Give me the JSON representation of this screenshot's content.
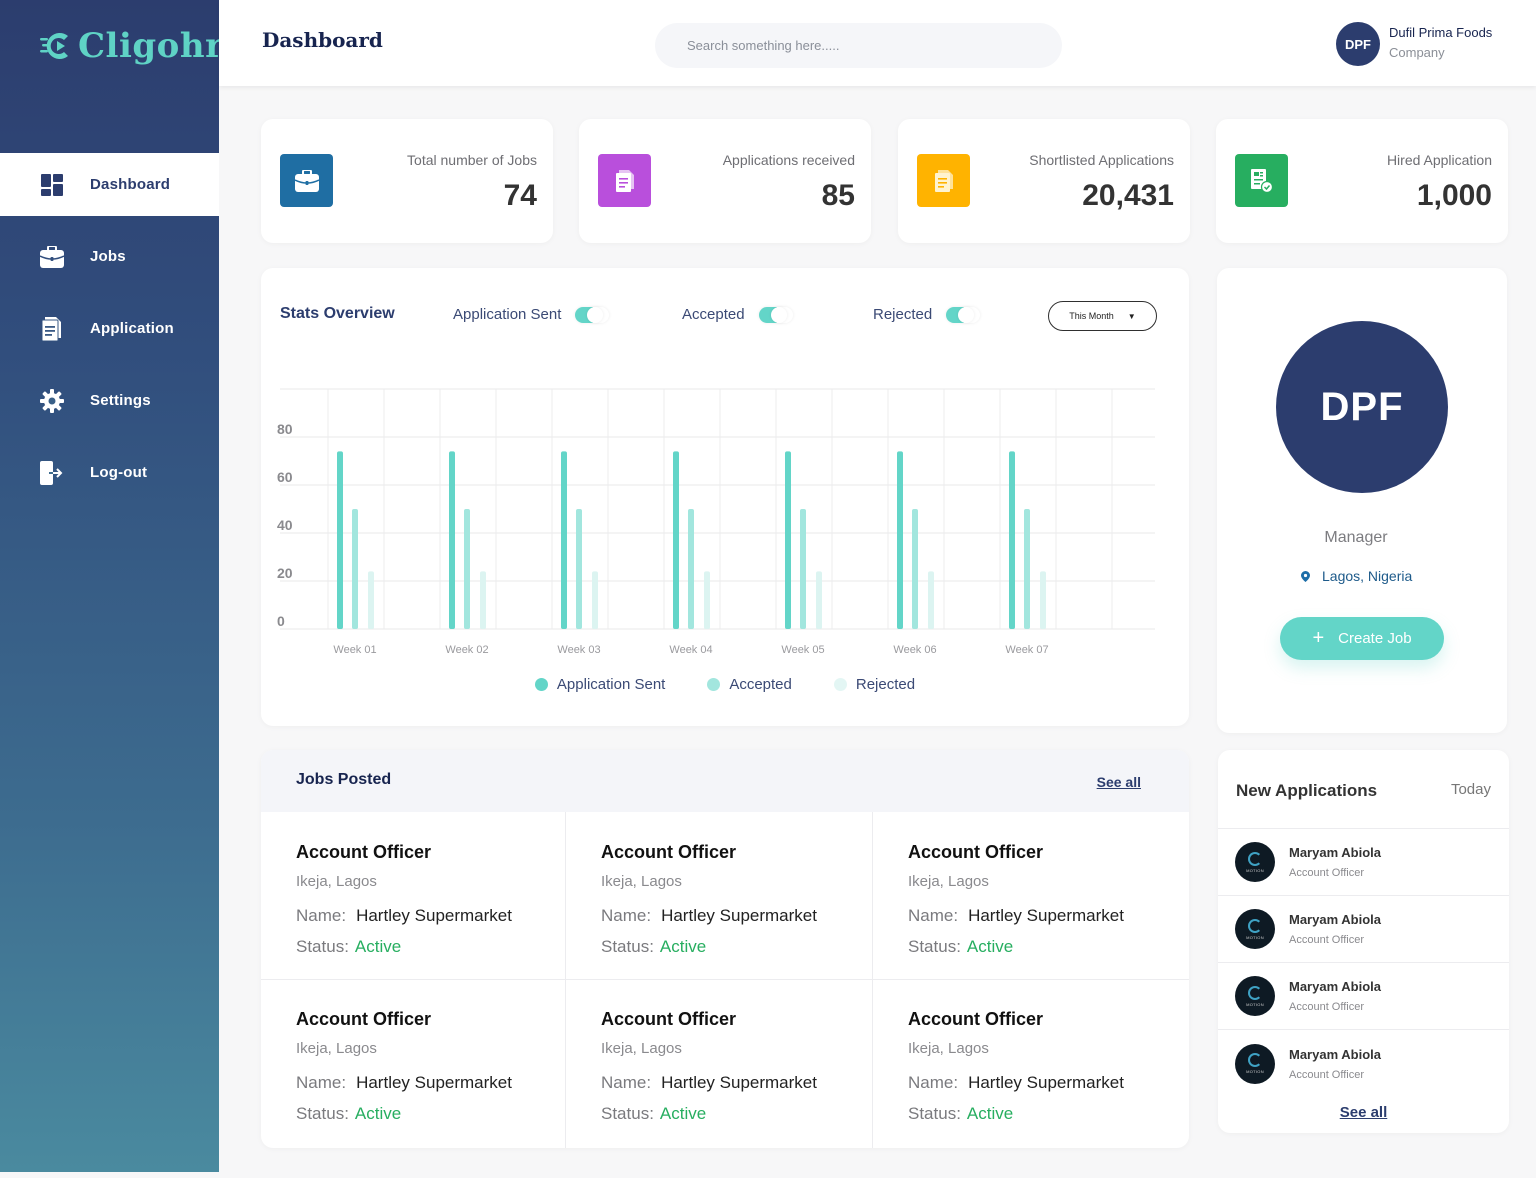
{
  "app": {
    "brand": "Cligohr",
    "brand_color": "#5fd3c5",
    "sidebar_color": "#2c3d6e",
    "accent": "#63d5c8"
  },
  "sidebar": {
    "items": [
      {
        "label": "Dashboard",
        "icon": "dashboard-icon",
        "active": true
      },
      {
        "label": "Jobs",
        "icon": "briefcase-icon",
        "active": false
      },
      {
        "label": "Application",
        "icon": "document-icon",
        "active": false
      },
      {
        "label": "Settings",
        "icon": "gear-icon",
        "active": false
      },
      {
        "label": "Log-out",
        "icon": "logout-icon",
        "active": false
      }
    ]
  },
  "header": {
    "title": "Dashboard",
    "search_placeholder": "Search something here.....",
    "user": {
      "initials": "DPF",
      "name": "Dufil Prima Foods",
      "role": "Company"
    }
  },
  "stats": [
    {
      "label": "Total number of Jobs",
      "value": "74",
      "icon": "briefcase-icon",
      "color": "#1f6ea3"
    },
    {
      "label": "Applications received",
      "value": "85",
      "icon": "document-icon",
      "color": "#b94fdc"
    },
    {
      "label": "Shortlisted Applications",
      "value": "20,431",
      "icon": "document-icon",
      "color": "#ffb300"
    },
    {
      "label": "Hired Application",
      "value": "1,000",
      "icon": "hired-document-icon",
      "color": "#27ae60"
    }
  ],
  "stats_overview": {
    "title": "Stats Overview",
    "toggles": [
      {
        "label": "Application Sent",
        "on": true
      },
      {
        "label": "Accepted",
        "on": true
      },
      {
        "label": "Rejected",
        "on": true
      }
    ],
    "period": "This Month"
  },
  "chart_data": {
    "type": "bar",
    "title": "Stats Overview",
    "xlabel": "",
    "ylabel": "",
    "categories": [
      "Week 01",
      "Week 02",
      "Week 03",
      "Week 04",
      "Week 05",
      "Week 06",
      "Week 07"
    ],
    "series": [
      {
        "name": "Application Sent",
        "color": "#63d5c8",
        "values": [
          74,
          74,
          74,
          74,
          74,
          74,
          74
        ]
      },
      {
        "name": "Accepted",
        "color": "#a2e6de",
        "values": [
          50,
          50,
          50,
          50,
          50,
          50,
          50
        ]
      },
      {
        "name": "Rejected",
        "color": "#dcf4f1",
        "values": [
          24,
          24,
          24,
          24,
          24,
          24,
          24
        ]
      }
    ],
    "yticks": [
      0,
      20,
      40,
      60,
      80
    ],
    "ylim": [
      0,
      100
    ],
    "grid": true,
    "legend": "bottom-center"
  },
  "profile": {
    "initials": "DPF",
    "role": "Manager",
    "location": "Lagos, Nigeria",
    "create_button": "Create Job"
  },
  "jobs_posted": {
    "title": "Jobs Posted",
    "see_all": "See all",
    "name_label": "Name:",
    "status_label": "Status:",
    "jobs": [
      {
        "title": "Account Officer",
        "location": "Ikeja, Lagos",
        "name": "Hartley Supermarket",
        "status": "Active"
      },
      {
        "title": "Account Officer",
        "location": "Ikeja, Lagos",
        "name": "Hartley Supermarket",
        "status": "Active"
      },
      {
        "title": "Account Officer",
        "location": "Ikeja, Lagos",
        "name": "Hartley Supermarket",
        "status": "Active"
      },
      {
        "title": "Account Officer",
        "location": "Ikeja, Lagos",
        "name": "Hartley Supermarket",
        "status": "Active"
      },
      {
        "title": "Account Officer",
        "location": "Ikeja, Lagos",
        "name": "Hartley Supermarket",
        "status": "Active"
      },
      {
        "title": "Account Officer",
        "location": "Ikeja, Lagos",
        "name": "Hartley Supermarket",
        "status": "Active"
      }
    ]
  },
  "new_applications": {
    "title": "New Applications",
    "period": "Today",
    "see_all": "See all",
    "avatar_tag": "MOTION",
    "items": [
      {
        "name": "Maryam Abiola",
        "role": "Account Officer"
      },
      {
        "name": "Maryam Abiola",
        "role": "Account Officer"
      },
      {
        "name": "Maryam Abiola",
        "role": "Account Officer"
      },
      {
        "name": "Maryam Abiola",
        "role": "Account Officer"
      }
    ]
  }
}
